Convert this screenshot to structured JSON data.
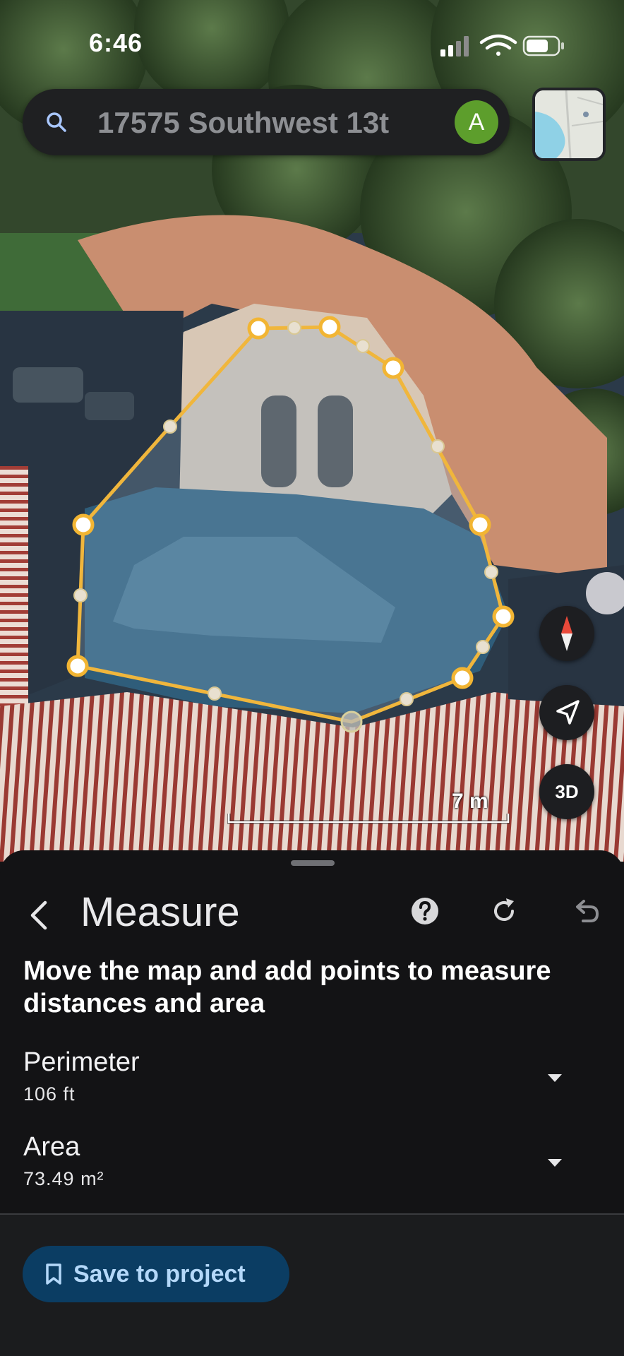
{
  "status_bar": {
    "time": "6:46"
  },
  "search": {
    "query": "17575 Southwest 13t",
    "avatar_letter": "A"
  },
  "map": {
    "scale_label": "7 m",
    "controls": {
      "compass_icon": "compass-icon",
      "location_icon": "navigate-arrow-icon",
      "view_3d_label": "3D"
    }
  },
  "sheet": {
    "title": "Measure",
    "instruction": "Move the map and add points to measure distances and area",
    "perimeter": {
      "label": "Perimeter",
      "value": "106 ft"
    },
    "area": {
      "label": "Area",
      "value": "73.49 m²"
    },
    "icons": {
      "back": "chevron-left-icon",
      "help": "help-circle-icon",
      "refresh": "refresh-icon",
      "undo": "undo-icon"
    }
  },
  "footer": {
    "save_label": "Save to project",
    "save_icon": "bookmark-icon"
  },
  "colors": {
    "accent": "#f2b533",
    "sheet_bg": "#131315",
    "save_bg": "#0b3d63",
    "save_text": "#b4d8f9"
  }
}
